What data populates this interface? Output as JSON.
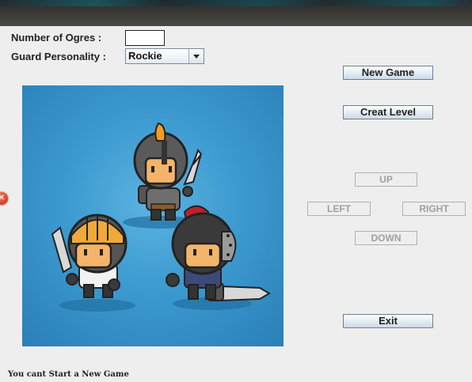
{
  "form": {
    "ogres_label": "Number of Ogres :",
    "ogres_value": "",
    "personality_label": "Guard Personality :",
    "personality_selected": "Rockie"
  },
  "buttons": {
    "new_game": "New Game",
    "create_level": "Creat Level",
    "up": "UP",
    "left": "LEFT",
    "right": "RIGHT",
    "down": "DOWN",
    "exit": "Exit"
  },
  "status": {
    "message": "You cant Start a New Game"
  },
  "image": {
    "description_icon": "three-knights-illustration"
  },
  "colors": {
    "scene_background": "#3c9ad0",
    "button_border": "#6b7f93",
    "disabled_text": "#a0a0a0"
  }
}
